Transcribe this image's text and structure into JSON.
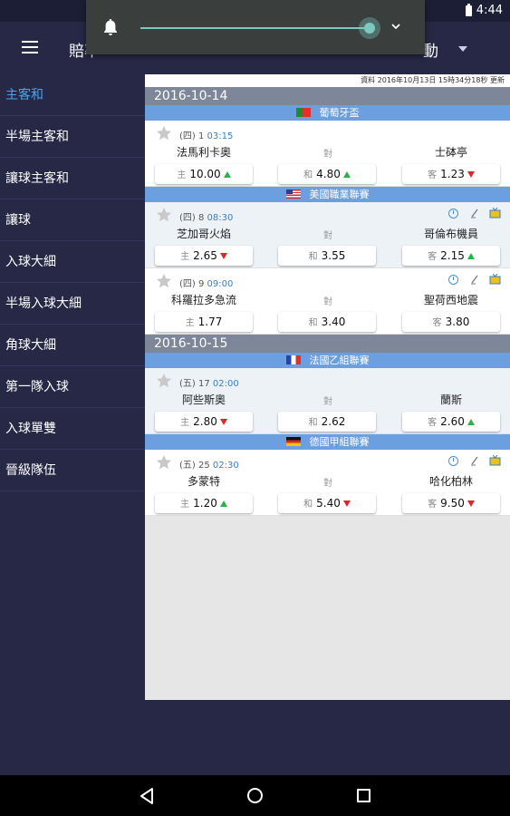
{
  "status": {
    "time": "4:44"
  },
  "header": {
    "title": "賠率",
    "right_title": "動"
  },
  "sidebar": {
    "items": [
      {
        "label": "主客和"
      },
      {
        "label": "半場主客和"
      },
      {
        "label": "讓球主客和"
      },
      {
        "label": "讓球"
      },
      {
        "label": "入球大細"
      },
      {
        "label": "半場入球大細"
      },
      {
        "label": "角球大細"
      },
      {
        "label": "第一隊入球"
      },
      {
        "label": "入球單雙"
      },
      {
        "label": "晉級隊伍"
      }
    ]
  },
  "volume": {
    "level": 0.85
  },
  "content": {
    "updated": "資料 2016年10月13日 15時34分18秒 更新",
    "vs_label": "對",
    "home_label": "主",
    "draw_label": "和",
    "away_label": "客",
    "sections": [
      {
        "date": "2016-10-14",
        "leagues": [
          {
            "name": "葡萄牙盃",
            "flag": "pt",
            "matches": [
              {
                "day": "(四) 1",
                "time": "03:15",
                "home": "法馬利卡奧",
                "away": "士砵亭",
                "home_odd": "10.00",
                "home_trend": "up",
                "draw_odd": "4.80",
                "draw_trend": "up",
                "away_odd": "1.23",
                "away_trend": "down"
              }
            ]
          },
          {
            "name": "美國職業聯賽",
            "flag": "us",
            "matches": [
              {
                "day": "(四) 8",
                "time": "08:30",
                "home": "芝加哥火焰",
                "away": "哥倫布機員",
                "home_odd": "2.65",
                "home_trend": "down",
                "draw_odd": "3.55",
                "draw_trend": "",
                "away_odd": "2.15",
                "away_trend": "up"
              },
              {
                "day": "(四) 9",
                "time": "09:00",
                "home": "科羅拉多急流",
                "away": "聖荷西地震",
                "home_odd": "1.77",
                "home_trend": "",
                "draw_odd": "3.40",
                "draw_trend": "",
                "away_odd": "3.80",
                "away_trend": ""
              }
            ]
          }
        ]
      },
      {
        "date": "2016-10-15",
        "leagues": [
          {
            "name": "法國乙組聯賽",
            "flag": "fr",
            "matches": [
              {
                "day": "(五) 17",
                "time": "02:00",
                "home": "阿些斯奧",
                "away": "蘭斯",
                "home_odd": "2.80",
                "home_trend": "down",
                "draw_odd": "2.62",
                "draw_trend": "",
                "away_odd": "2.60",
                "away_trend": "up"
              }
            ]
          },
          {
            "name": "德國甲組聯賽",
            "flag": "de",
            "matches": [
              {
                "day": "(五) 25",
                "time": "02:30",
                "home": "多蒙特",
                "away": "哈化柏林",
                "home_odd": "1.20",
                "home_trend": "up",
                "draw_odd": "5.40",
                "draw_trend": "down",
                "away_odd": "9.50",
                "away_trend": "down"
              }
            ]
          }
        ]
      }
    ]
  }
}
